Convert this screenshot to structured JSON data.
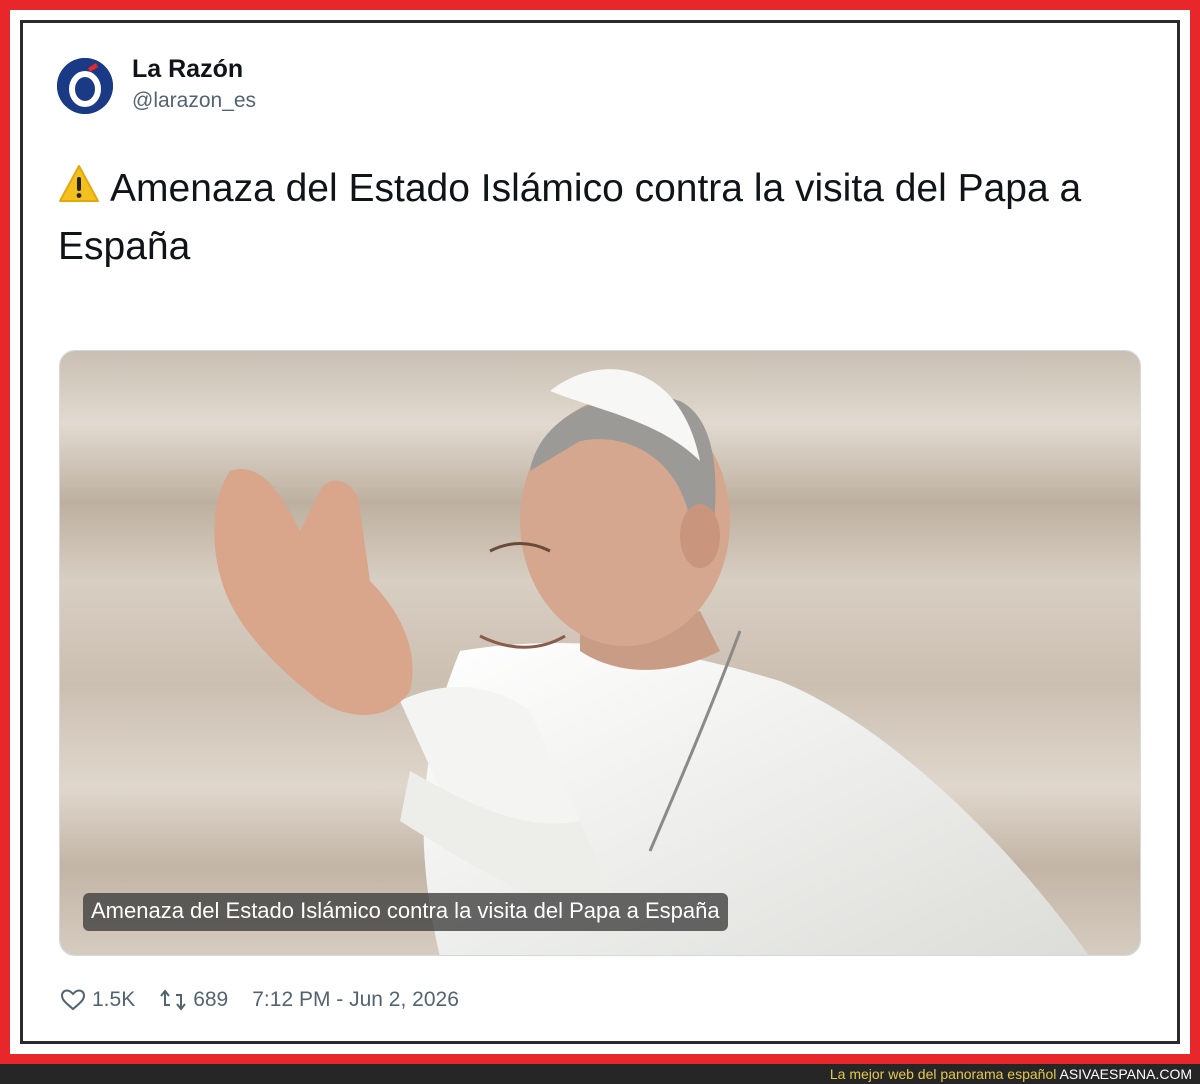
{
  "author": {
    "name": "La Razón",
    "handle": "@larazon_es",
    "avatar_letter": "Ó",
    "avatar_color": "#1b3a86"
  },
  "tweet": {
    "text": "Amenaza del Estado Islámico contra la visita del Papa a España",
    "lead_icon": "warning-icon"
  },
  "media": {
    "caption": "Amenaza del Estado Islámico contra la visita del Papa a España"
  },
  "stats": {
    "likes": "1.5K",
    "retweets": "689",
    "timestamp": "7:12 PM - Jun 2, 2026"
  },
  "footer": {
    "tagline": "La mejor web del panorama español",
    "brand": "ASIVAESPANA.COM"
  },
  "colors": {
    "frame": "#e8272a",
    "text": "#0f1419",
    "muted": "#536471",
    "footer_bg": "#262626",
    "footer_text": "#e4c94c"
  }
}
